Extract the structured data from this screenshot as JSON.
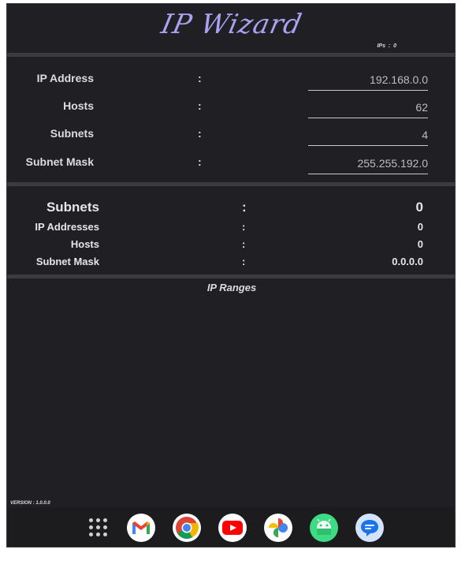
{
  "app": {
    "title": "IP Wizard",
    "ips_label": "IPs",
    "ips_sep": ":",
    "ips_count": "0",
    "version_label": "VERSION",
    "version_sep": ":",
    "version_value": "1.0.0.0"
  },
  "inputs": [
    {
      "label": "IP Address",
      "sep": ":",
      "value": "192.168.0.0"
    },
    {
      "label": "Hosts",
      "sep": ":",
      "value": "62"
    },
    {
      "label": "Subnets",
      "sep": ":",
      "value": "4"
    },
    {
      "label": "Subnet Mask",
      "sep": ":",
      "value": "255.255.192.0"
    }
  ],
  "results": [
    {
      "label": "Subnets",
      "sep": ":",
      "value": "0"
    },
    {
      "label": "IP Addresses",
      "sep": ":",
      "value": "0"
    },
    {
      "label": "Hosts",
      "sep": ":",
      "value": "0"
    },
    {
      "label": "Subnet Mask",
      "sep": ":",
      "value": "0.0.0.0"
    }
  ],
  "ranges": {
    "title": "IP Ranges"
  },
  "dock": {
    "items": [
      "app-drawer-icon",
      "gmail-icon",
      "chrome-icon",
      "youtube-icon",
      "photos-icon",
      "android-icon",
      "messages-icon"
    ]
  },
  "colors": {
    "background": "#202024",
    "title": "#a9a2f2",
    "separator": "#3c3c40",
    "text": "#dcdcdc"
  }
}
